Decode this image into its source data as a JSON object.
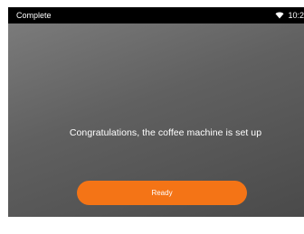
{
  "status_bar": {
    "title": "Complete",
    "time": "10:2",
    "wifi_icon": "wifi-icon"
  },
  "main": {
    "message": "Congratulations, the coffee machine is set up"
  },
  "actions": {
    "ready_label": "Ready"
  },
  "colors": {
    "accent": "#f47416",
    "status_bar": "#000000",
    "background_gradient_start": "#7e7e7e",
    "background_gradient_end": "#4a4a4a"
  }
}
